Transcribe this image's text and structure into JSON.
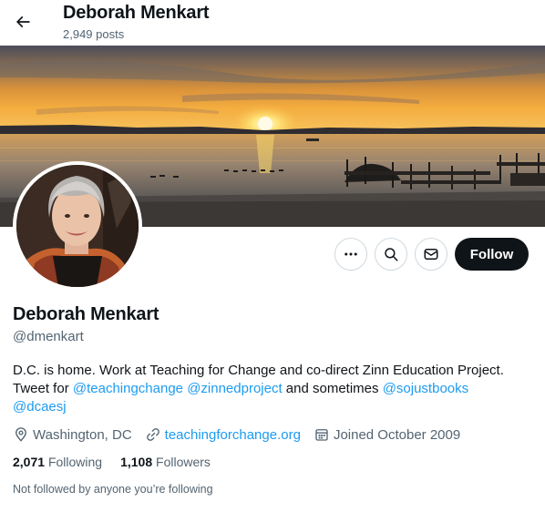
{
  "header": {
    "name": "Deborah Menkart",
    "posts": "2,949 posts"
  },
  "profile": {
    "display_name": "Deborah Menkart",
    "handle": "@dmenkart",
    "bio": {
      "line1": "D.C. is home. Work at Teaching for Change and co-direct Zinn Education Project.",
      "tweet_for": "Tweet for ",
      "mention1": "@teachingchange",
      "mention2": "@zinnedproject",
      "and_sometimes": " and sometimes ",
      "mention3": "@sojustbooks",
      "mention4": "@dcaesj"
    },
    "location": "Washington, DC",
    "website": "teachingforchange.org",
    "joined": "Joined October 2009",
    "following_count": "2,071",
    "following_label": "Following",
    "followers_count": "1,108",
    "followers_label": "Followers",
    "not_followed": "Not followed by anyone you’re following"
  },
  "actions": {
    "follow_label": "Follow",
    "icons": [
      "more-icon",
      "search-icon",
      "message-icon"
    ]
  },
  "colors": {
    "accent": "#1d9bf0",
    "text": "#0f1419",
    "secondary": "#536471",
    "button_dark": "#0f1419"
  }
}
